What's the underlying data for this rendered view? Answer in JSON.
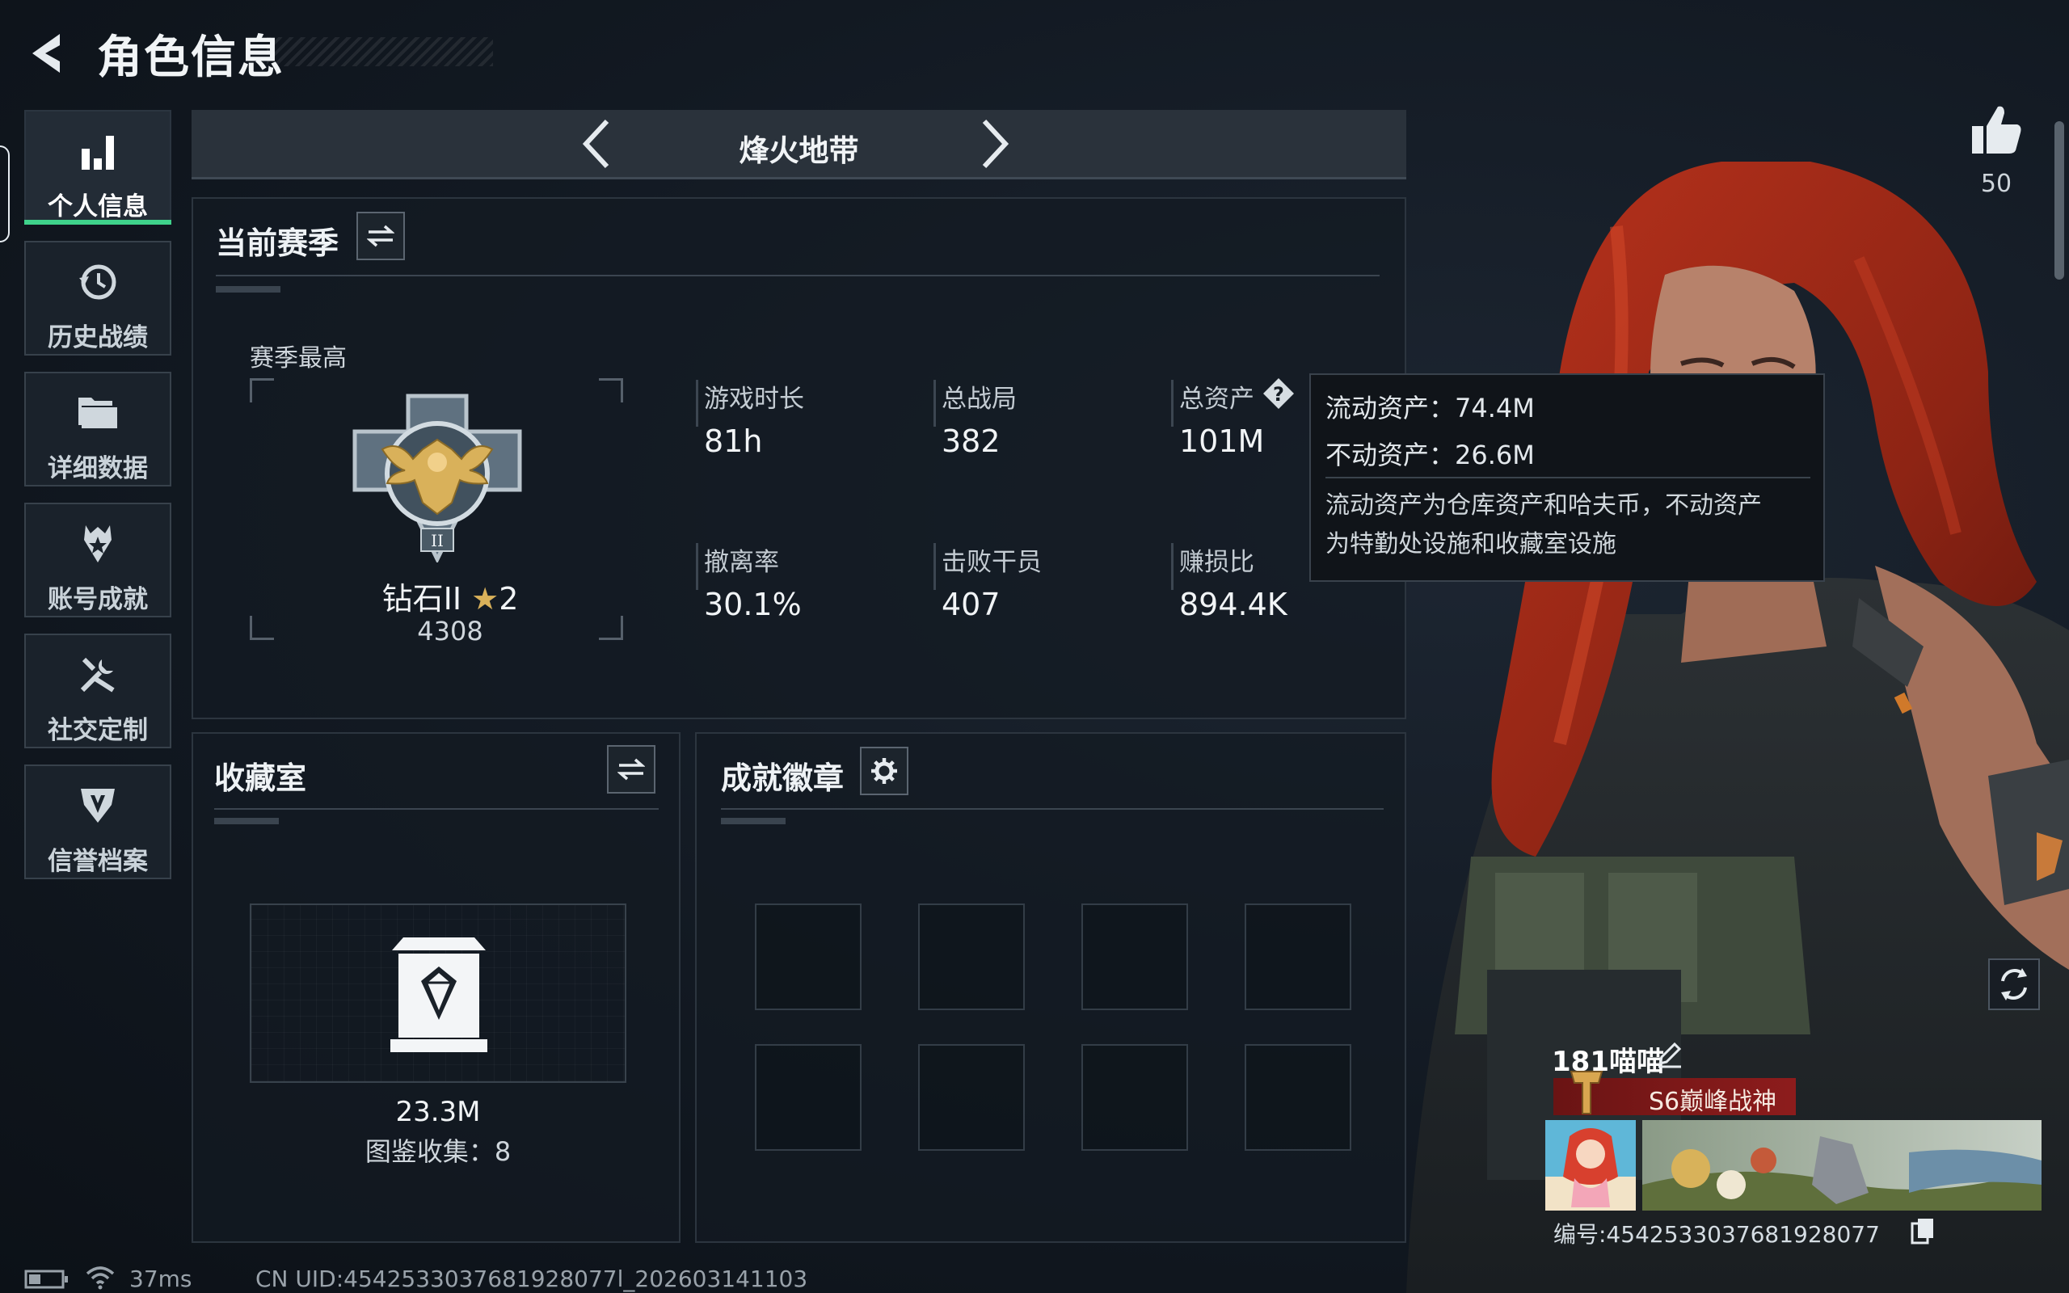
{
  "header": {
    "title": "角色信息",
    "back_icon": "back-arrow-icon"
  },
  "sidebar": {
    "items": [
      {
        "label": "个人信息",
        "icon": "bar-chart-icon",
        "active": true
      },
      {
        "label": "历史战绩",
        "icon": "history-clock-icon",
        "active": false
      },
      {
        "label": "详细数据",
        "icon": "folder-icon",
        "active": false
      },
      {
        "label": "账号成就",
        "icon": "achievement-medal-icon",
        "active": false
      },
      {
        "label": "社交定制",
        "icon": "tools-icon",
        "active": false
      },
      {
        "label": "信誉档案",
        "icon": "shield-credit-icon",
        "active": false
      }
    ]
  },
  "mode_selector": {
    "label": "烽火地带",
    "prev_icon": "chevron-left-icon",
    "next_icon": "chevron-right-icon"
  },
  "season": {
    "title": "当前赛季",
    "best_label": "赛季最高",
    "rank_name": "钻石II",
    "stars": "2",
    "rank_score": "4308",
    "stats": [
      {
        "label": "游戏时长",
        "value": "81h"
      },
      {
        "label": "总战局",
        "value": "382"
      },
      {
        "label": "总资产",
        "value": "101M"
      },
      {
        "label": "撤离率",
        "value": "30.1%"
      },
      {
        "label": "击败干员",
        "value": "407"
      },
      {
        "label": "赚损比",
        "value": "894.4K"
      }
    ]
  },
  "tooltip": {
    "liquid": "流动资产：74.4M",
    "fixed": "不动资产：26.6M",
    "desc_line1": "流动资产为仓库资产和哈夫币，不动资产",
    "desc_line2": "为特勤处设施和收藏室设施"
  },
  "collection": {
    "title": "收藏室",
    "value": "23.3M",
    "count_text": "图鉴收集：8"
  },
  "badges": {
    "title": "成就徽章",
    "slot_count": 8
  },
  "like": {
    "count": "50"
  },
  "player": {
    "name": "181喵喵",
    "title": "S6巅峰战神",
    "id_text": "编号:4542533037681928077"
  },
  "footer": {
    "latency": "37ms",
    "uid": "CN UID:4542533037681928077l_202603141103"
  },
  "colors": {
    "active_green": "#3fd28b",
    "title_red": "#8d1c1c",
    "rank_gold": "#d9b15a"
  }
}
